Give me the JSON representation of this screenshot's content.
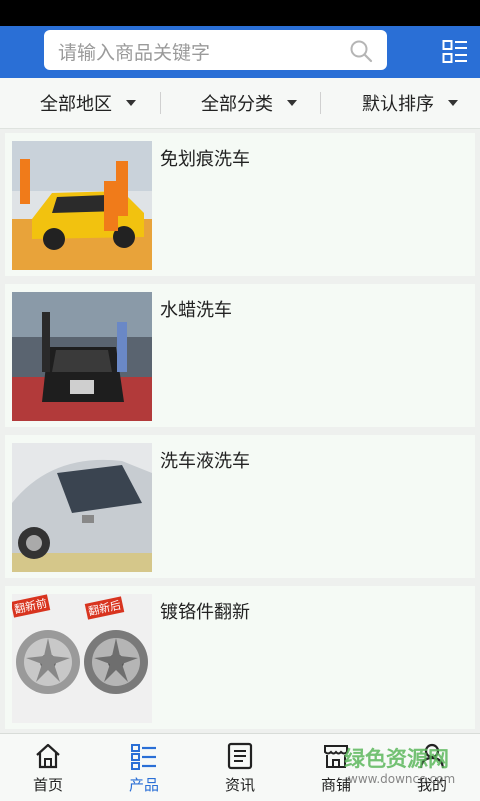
{
  "search": {
    "placeholder": "请输入商品关键字"
  },
  "filters": [
    {
      "label": "全部地区"
    },
    {
      "label": "全部分类"
    },
    {
      "label": "默认排序"
    }
  ],
  "products": [
    {
      "title": "免划痕洗车"
    },
    {
      "title": "水蜡洗车"
    },
    {
      "title": "洗车液洗车"
    },
    {
      "title": "镀铬件翻新",
      "image_labels": [
        "翻新前",
        "翻新后"
      ]
    }
  ],
  "tabs": [
    {
      "label": "首页",
      "icon": "home-icon"
    },
    {
      "label": "产品",
      "icon": "list-icon",
      "active": true
    },
    {
      "label": "资讯",
      "icon": "news-icon"
    },
    {
      "label": "商铺",
      "icon": "store-icon"
    },
    {
      "label": "我的",
      "icon": "user-icon"
    }
  ],
  "watermark": {
    "text": "绿色资源网",
    "url": "www.downcc.com"
  },
  "colors": {
    "primary": "#2a6fd6",
    "background": "#eef0ee",
    "card": "#f5faf5"
  }
}
